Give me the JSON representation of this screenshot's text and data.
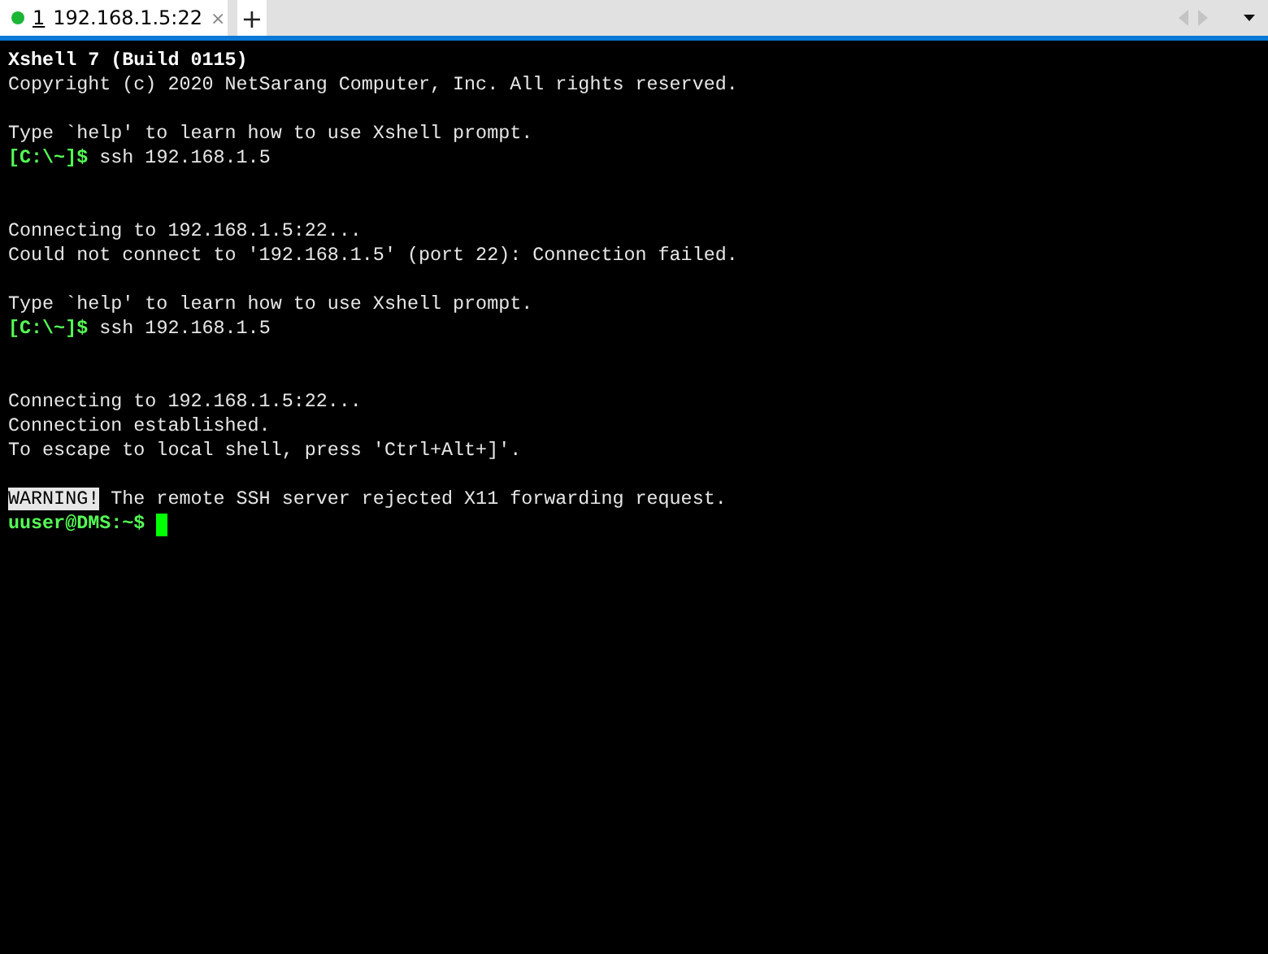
{
  "tabs": [
    {
      "number": "1",
      "label": "192.168.1.5:22",
      "close": "×",
      "connected": true,
      "selected": true
    }
  ],
  "new_tab": "+",
  "terminal": {
    "lines": [
      {
        "kind": "text",
        "segments": [
          {
            "kind": "bold",
            "text": "Xshell 7 (Build 0115)"
          }
        ]
      },
      {
        "kind": "text",
        "segments": [
          {
            "kind": "plain",
            "text": "Copyright (c) 2020 NetSarang Computer, Inc. All rights reserved."
          }
        ]
      },
      {
        "kind": "blank"
      },
      {
        "kind": "text",
        "segments": [
          {
            "kind": "plain",
            "text": "Type `help' to learn how to use Xshell prompt."
          }
        ]
      },
      {
        "kind": "text",
        "segments": [
          {
            "kind": "prompt",
            "text": "[C:\\~]$"
          },
          {
            "kind": "plain",
            "text": " ssh 192.168.1.5"
          }
        ]
      },
      {
        "kind": "blank"
      },
      {
        "kind": "blank"
      },
      {
        "kind": "text",
        "segments": [
          {
            "kind": "plain",
            "text": "Connecting to 192.168.1.5:22..."
          }
        ]
      },
      {
        "kind": "text",
        "segments": [
          {
            "kind": "plain",
            "text": "Could not connect to '192.168.1.5' (port 22): Connection failed."
          }
        ]
      },
      {
        "kind": "blank"
      },
      {
        "kind": "text",
        "segments": [
          {
            "kind": "plain",
            "text": "Type `help' to learn how to use Xshell prompt."
          }
        ]
      },
      {
        "kind": "text",
        "segments": [
          {
            "kind": "prompt",
            "text": "[C:\\~]$"
          },
          {
            "kind": "plain",
            "text": " ssh 192.168.1.5"
          }
        ]
      },
      {
        "kind": "blank"
      },
      {
        "kind": "blank"
      },
      {
        "kind": "text",
        "segments": [
          {
            "kind": "plain",
            "text": "Connecting to 192.168.1.5:22..."
          }
        ]
      },
      {
        "kind": "text",
        "segments": [
          {
            "kind": "plain",
            "text": "Connection established."
          }
        ]
      },
      {
        "kind": "text",
        "segments": [
          {
            "kind": "plain",
            "text": "To escape to local shell, press 'Ctrl+Alt+]'."
          }
        ]
      },
      {
        "kind": "blank"
      },
      {
        "kind": "text",
        "segments": [
          {
            "kind": "inverse",
            "text": "WARNING!"
          },
          {
            "kind": "plain",
            "text": " The remote SSH server rejected X11 forwarding request."
          }
        ]
      },
      {
        "kind": "text",
        "segments": [
          {
            "kind": "prompt",
            "text": "uuser@DMS:~$"
          }
        ],
        "cursor": true
      }
    ]
  }
}
